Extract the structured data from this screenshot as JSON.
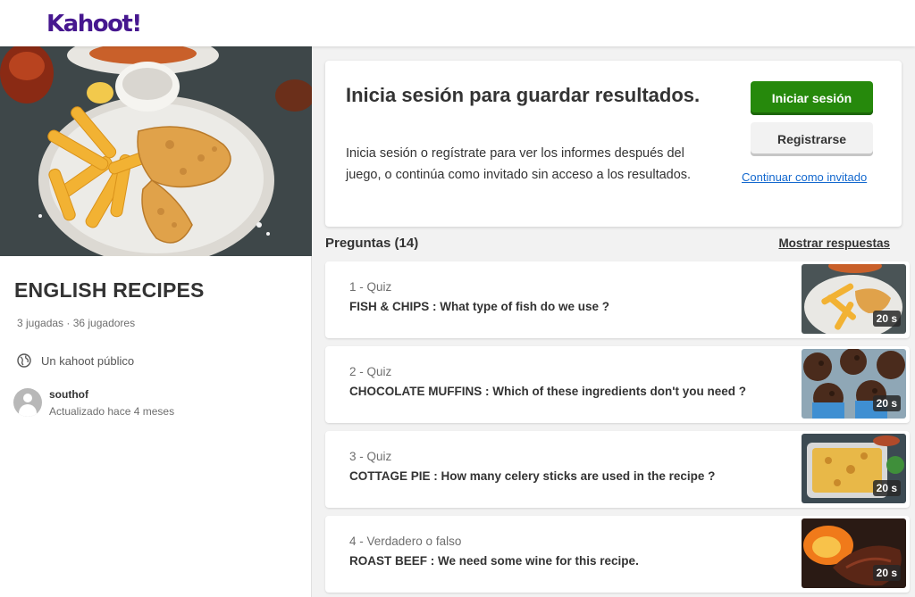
{
  "header": {
    "logo_text": "Kahoot!"
  },
  "kahoot": {
    "title": "ENGLISH RECIPES",
    "meta": "3 jugadas · 36 jugadores",
    "visibility": "Un kahoot público",
    "owner_name": "southof",
    "owner_updated": "Actualizado hace 4 meses"
  },
  "login": {
    "heading": "Inicia sesión para guardar resultados.",
    "text": "Inicia sesión o regístrate para ver los informes después del juego, o continúa como invitado sin acceso a los resultados.",
    "login_button": "Iniciar sesión",
    "register_button": "Registrarse",
    "guest_link": "Continuar como invitado"
  },
  "questions": {
    "title": "Preguntas (14)",
    "show_answers": "Mostrar respuestas",
    "items": [
      {
        "type": "1 - Quiz",
        "text": "FISH & CHIPS : What type of fish do we use ?",
        "time": "20 s",
        "image": "fish-and-chips"
      },
      {
        "type": "2 - Quiz",
        "text": "CHOCOLATE MUFFINS : Which of these ingredients don't you need ?",
        "time": "20 s",
        "image": "chocolate-muffins"
      },
      {
        "type": "3 - Quiz",
        "text": "COTTAGE PIE : How many celery sticks are used in the recipe ?",
        "time": "20 s",
        "image": "cottage-pie"
      },
      {
        "type": "4 - Verdadero o falso",
        "text": "ROAST BEEF : We need some wine for this recipe.",
        "time": "20 s",
        "image": "roast-beef"
      }
    ]
  },
  "colors": {
    "brand": "#46178f",
    "login_button": "#26890c",
    "link": "#1368ce"
  }
}
